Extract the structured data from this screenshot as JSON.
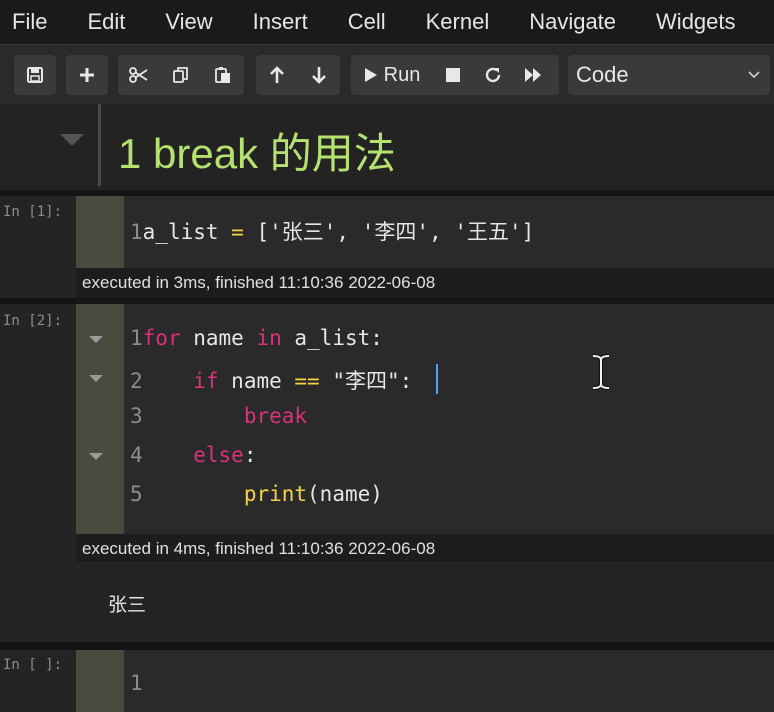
{
  "menu": [
    "File",
    "Edit",
    "View",
    "Insert",
    "Cell",
    "Kernel",
    "Navigate",
    "Widgets"
  ],
  "toolbar": {
    "icons": [
      "save-icon",
      "plus-icon",
      "scissors-icon",
      "copy-icon",
      "paste-icon",
      "arrow-up-icon",
      "arrow-down-icon",
      "play-icon",
      "stop-icon",
      "restart-icon",
      "fast-forward-icon"
    ],
    "run_label": "Run",
    "cell_type": "Code"
  },
  "markdown": {
    "heading": "1  break 的用法"
  },
  "cells": [
    {
      "prompt": "In [1]:",
      "lines": [
        {
          "n": "1",
          "tokens": [
            {
              "t": "a_list ",
              "c": "pl"
            },
            {
              "t": "=",
              "c": "op"
            },
            {
              "t": " [",
              "c": "pl"
            },
            {
              "t": "'张三'",
              "c": "str"
            },
            {
              "t": ", ",
              "c": "pl"
            },
            {
              "t": "'李四'",
              "c": "str"
            },
            {
              "t": ", ",
              "c": "pl"
            },
            {
              "t": "'王五'",
              "c": "str"
            },
            {
              "t": "]",
              "c": "pl"
            }
          ]
        }
      ],
      "exec": "executed in 3ms, finished 11:10:36 2022-06-08"
    },
    {
      "prompt": "In [2]:",
      "lines": [
        {
          "n": "1",
          "tokens": [
            {
              "t": "for",
              "c": "kw"
            },
            {
              "t": " name ",
              "c": "pl"
            },
            {
              "t": "in",
              "c": "kw"
            },
            {
              "t": " a_list:",
              "c": "pl"
            }
          ]
        },
        {
          "n": "2",
          "tokens": [
            {
              "t": "    ",
              "c": "pl"
            },
            {
              "t": "if",
              "c": "kw"
            },
            {
              "t": " name ",
              "c": "pl"
            },
            {
              "t": "==",
              "c": "op"
            },
            {
              "t": " ",
              "c": "pl"
            },
            {
              "t": "\"李四\"",
              "c": "str"
            },
            {
              "t": ":",
              "c": "pl"
            }
          ]
        },
        {
          "n": "3",
          "tokens": [
            {
              "t": "        ",
              "c": "pl"
            },
            {
              "t": "break",
              "c": "kw"
            }
          ]
        },
        {
          "n": "4",
          "tokens": [
            {
              "t": "    ",
              "c": "pl"
            },
            {
              "t": "else",
              "c": "kw"
            },
            {
              "t": ":",
              "c": "pl"
            }
          ]
        },
        {
          "n": "5",
          "tokens": [
            {
              "t": "        ",
              "c": "pl"
            },
            {
              "t": "print",
              "c": "op"
            },
            {
              "t": "(name)",
              "c": "pl"
            }
          ]
        }
      ],
      "exec": "executed in 4ms, finished 11:10:36 2022-06-08",
      "output": "张三"
    },
    {
      "prompt": "In [ ]:",
      "lines": [
        {
          "n": "1",
          "tokens": []
        }
      ]
    }
  ],
  "colors": {
    "keyword": "#d9317a",
    "operator": "#f7d347",
    "heading": "#b5e26e",
    "cursor": "#4da3ff"
  }
}
